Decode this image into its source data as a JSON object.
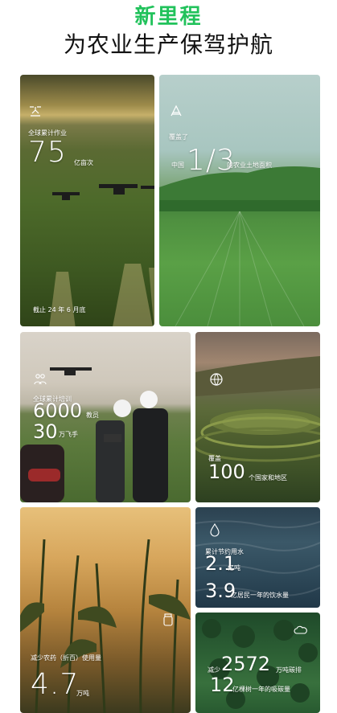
{
  "header": {
    "title_green": "新里程",
    "title_black": "为农业生产保驾护航"
  },
  "cards": {
    "global_ops": {
      "label": "全球累计作业",
      "value": "75",
      "unit": "亿亩次",
      "note": "截止 24 年 6 月底",
      "icon": "drone-icon"
    },
    "china_coverage": {
      "label_top": "覆盖了",
      "prefix": "中国",
      "value": "1/3",
      "suffix": "的农业土地面积",
      "icon": "field-icon"
    },
    "training": {
      "label": "全球累计培训",
      "value1": "6000",
      "unit1": "教员",
      "value2": "30",
      "unit2": "万飞手",
      "icon": "people-icon"
    },
    "countries": {
      "label": "覆盖",
      "value": "100",
      "unit": "个国家和地区",
      "icon": "globe-icon"
    },
    "pesticide": {
      "label": "减少农药（折百）使用量",
      "value": "4.7",
      "unit": "万吨",
      "icon": "bottle-icon"
    },
    "water": {
      "label": "累计节约用水",
      "value1": "2.1",
      "unit1": "亿吨",
      "value2": "3.9",
      "unit2": "亿居民一年的饮水量",
      "icon": "water-drop-icon"
    },
    "carbon": {
      "label": "减少",
      "value1": "2572",
      "unit1": "万吨碳排",
      "value2": "12",
      "unit2": "亿棵树一年的吸碳量",
      "icon": "co2-cloud-icon"
    }
  }
}
